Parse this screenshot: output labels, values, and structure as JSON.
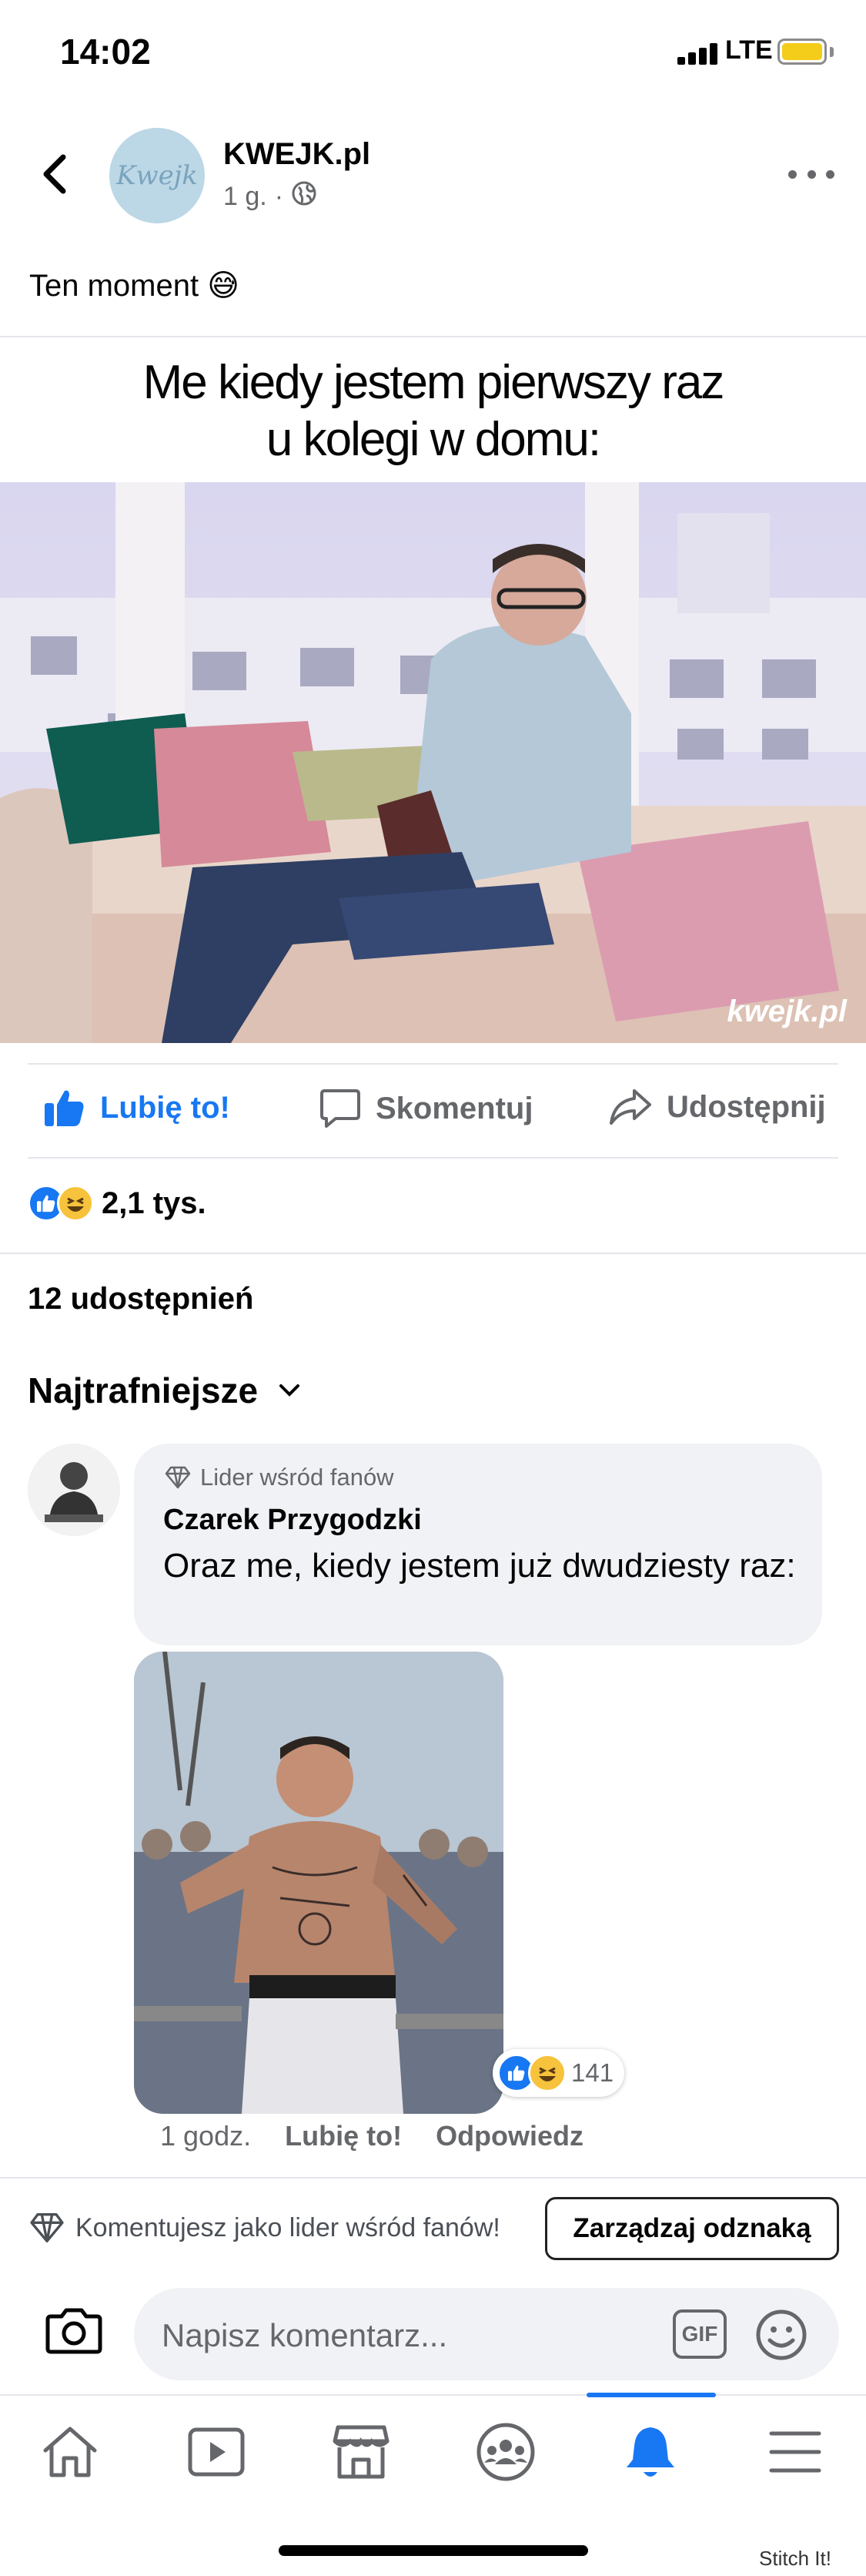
{
  "status_bar": {
    "time": "14:02",
    "network": "LTE",
    "battery_color": "#f4cc1a"
  },
  "post": {
    "page_name": "KWEJK.pl",
    "avatar_text": "Kwejk",
    "time_ago": "1 g.",
    "separator": "·",
    "privacy_icon": "globe-icon",
    "text": "Ten moment 😅",
    "meme_caption_line1": "Me kiedy jestem pierwszy raz",
    "meme_caption_line2": "u kolegi w domu:",
    "watermark": "kwejk.pl"
  },
  "actions": {
    "like": "Lubię to!",
    "comment": "Skomentuj",
    "share": "Udostępnij"
  },
  "reactions": {
    "count": "2,1 tys.",
    "types": [
      "like",
      "haha"
    ]
  },
  "shares": "12 udostępnień",
  "sort_label": "Najtrafniejsze",
  "comment": {
    "badge": "Lider wśród fanów",
    "author": "Czarek Przygodzki",
    "text": "Oraz me, kiedy jestem już dwudziesty raz:",
    "photo_reaction_count": "141",
    "time_ago": "1 godz.",
    "like_label": "Lubię to!",
    "reply_label": "Odpowiedz"
  },
  "fan_bar": {
    "text": "Komentujesz jako lider wśród fanów!",
    "button": "Zarządzaj odznaką"
  },
  "composer": {
    "placeholder": "Napisz komentarz...",
    "gif_label": "GIF"
  },
  "tabbar": {
    "active": "notifications",
    "items": [
      "home",
      "watch",
      "marketplace",
      "groups",
      "notifications",
      "menu"
    ]
  },
  "watermark_app": "Stitch It!",
  "colors": {
    "accent": "#1877f2",
    "secondary_text": "#65676b",
    "bubble_bg": "#f0f2f5"
  }
}
